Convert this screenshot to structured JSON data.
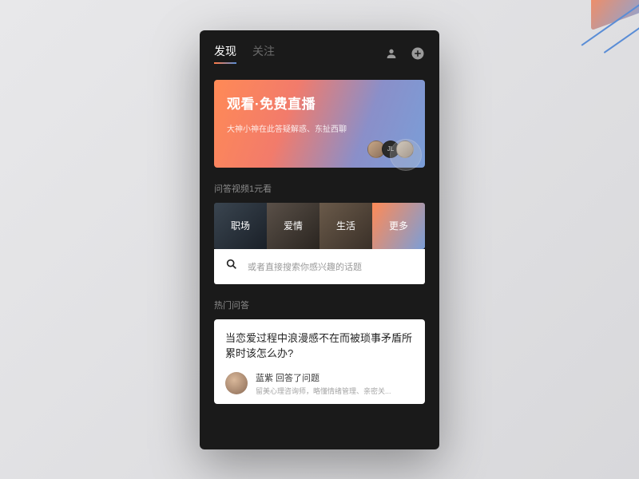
{
  "tabs": {
    "discover": "发现",
    "follow": "关注"
  },
  "banner": {
    "title": "观看·免费直播",
    "subtitle": "大神小神在此答疑解惑、东扯西聊",
    "avatar_label": "JL"
  },
  "section_video": "问答视频1元看",
  "categories": {
    "c1": "职场",
    "c2": "爱情",
    "c3": "生活",
    "c4": "更多"
  },
  "search": {
    "placeholder": "或者直接搜索你感兴趣的话题"
  },
  "section_hot": "热门问答",
  "hot": {
    "title": "当恋爱过程中浪漫感不在而被琐事矛盾所累时该怎么办?",
    "user_line": "蓝紫 回答了问题",
    "bio": "留美心理咨询师，略懂情绪管理、亲密关..."
  }
}
